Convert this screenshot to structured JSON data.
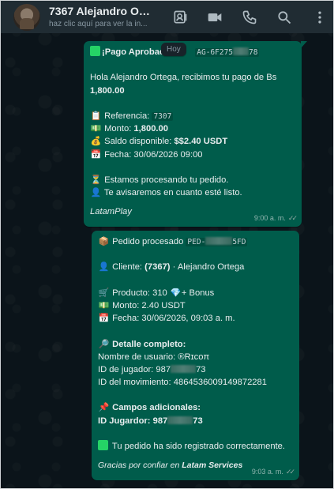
{
  "header": {
    "title": "7367 Alejandro Orte...",
    "subtitle": "haz clic aquí para ver la in...",
    "icons": [
      "contact-card-icon",
      "video-call-icon",
      "phone-icon",
      "search-icon",
      "more-options-icon"
    ]
  },
  "date_chip": "Hoy",
  "message1": {
    "title": "¡Pago Aprobac",
    "ref_code_start": "AG-6F275",
    "ref_code_end": "78",
    "greeting": "Hola Alejandro Ortega, recibimos tu pago de  Bs",
    "amount": "1,800.00",
    "reference_label": "Referencia:",
    "reference_value": "7307",
    "monto_label": "Monto:",
    "monto_value": "1,800.00",
    "saldo_label": "Saldo disponible:",
    "saldo_value": "$$2.40 USDT",
    "fecha_label": "Fecha:",
    "fecha_value": "30/06/2026 09:00",
    "processing": "Estamos procesando tu pedido.",
    "notify": "Te avisaremos en cuanto esté listo.",
    "signature": "LatamPlay",
    "time": "9:00 a. m."
  },
  "message2": {
    "title": "Pedido procesado",
    "order_code_start": "PED-",
    "order_code_end": "5FD",
    "cliente_label": "Cliente:",
    "cliente_id": "(7367)",
    "cliente_name": "· Alejandro Ortega",
    "producto_label": "Producto: 310",
    "producto_suffix": "+ Bonus",
    "monto_label": "Monto:",
    "monto_value": "2.40 USDT",
    "fecha_label": "Fecha:",
    "fecha_value": "30/06/2026, 09:03 a. m.",
    "detalle_title": "Detalle completo:",
    "usuario": "Nombre de usuario: ®Rɪcoπ",
    "jugador_label": "ID de jugador: 987",
    "jugador_end": "73",
    "movimiento": "ID del movimiento: 4864536009149872281",
    "campos_title": "Campos adicionales:",
    "id_jugador_label": "ID Jugardor:",
    "id_jugador_start": "987",
    "id_jugador_end": "73",
    "registrado": "Tu pedido ha sido registrado correctamente.",
    "gracias": "Gracias por confiar en",
    "gracias_brand": "Latam Services",
    "time": "9:03 a. m."
  },
  "colors": {
    "bubble": "#005c4b",
    "header": "#202c33",
    "background": "#0b141a"
  }
}
